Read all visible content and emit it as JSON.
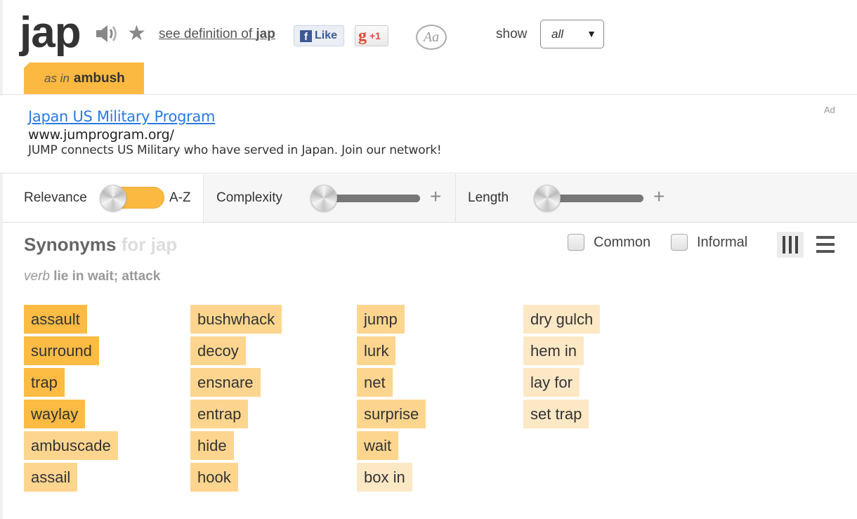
{
  "header": {
    "word": "jap",
    "icons": {
      "pronounce": "speaker-icon",
      "favorite": "star-icon",
      "font": "font-style-icon"
    },
    "see_definition_prefix": "see definition of ",
    "see_definition_word": "jap",
    "facebook_like": "Like",
    "facebook_letter": "f",
    "google_plus": "+1",
    "google_letter": "g",
    "font_toggle": "Aa",
    "show_label": "show",
    "show_value": "all",
    "sense_tab": {
      "prefix": "as in",
      "word": "ambush"
    }
  },
  "ad": {
    "title": "Japan US Military Program",
    "url": "www.jumprogram.org/",
    "description": "JUMP connects US Military who have served in Japan. Join our network!",
    "label": "Ad"
  },
  "filters": {
    "sort_left": "Relevance",
    "sort_right": "A-Z",
    "complexity": "Complexity",
    "complexity_value": 0,
    "length": "Length",
    "length_value": 0,
    "plus": "+"
  },
  "synonyms": {
    "title": "Synonyms",
    "title_suffix": "for jap",
    "pos": "verb",
    "definition": "lie in wait; attack",
    "filter_common": "Common",
    "filter_informal": "Informal",
    "colors": {
      "relevance_high": "#fcbb43",
      "relevance_mid": "#fdd58e",
      "relevance_low": "#fde8c5"
    },
    "columns": [
      [
        {
          "word": "assault",
          "relevance": 3
        },
        {
          "word": "surround",
          "relevance": 3
        },
        {
          "word": "trap",
          "relevance": 3
        },
        {
          "word": "waylay",
          "relevance": 3
        },
        {
          "word": "ambuscade",
          "relevance": 2
        },
        {
          "word": "assail",
          "relevance": 2
        }
      ],
      [
        {
          "word": "bushwhack",
          "relevance": 2
        },
        {
          "word": "decoy",
          "relevance": 2
        },
        {
          "word": "ensnare",
          "relevance": 2
        },
        {
          "word": "entrap",
          "relevance": 2
        },
        {
          "word": "hide",
          "relevance": 2
        },
        {
          "word": "hook",
          "relevance": 2
        }
      ],
      [
        {
          "word": "jump",
          "relevance": 2
        },
        {
          "word": "lurk",
          "relevance": 2
        },
        {
          "word": "net",
          "relevance": 2
        },
        {
          "word": "surprise",
          "relevance": 2
        },
        {
          "word": "wait",
          "relevance": 2
        },
        {
          "word": "box in",
          "relevance": 1
        }
      ],
      [
        {
          "word": "dry gulch",
          "relevance": 1
        },
        {
          "word": "hem in",
          "relevance": 1
        },
        {
          "word": "lay for",
          "relevance": 1
        },
        {
          "word": "set trap",
          "relevance": 1
        }
      ]
    ]
  }
}
